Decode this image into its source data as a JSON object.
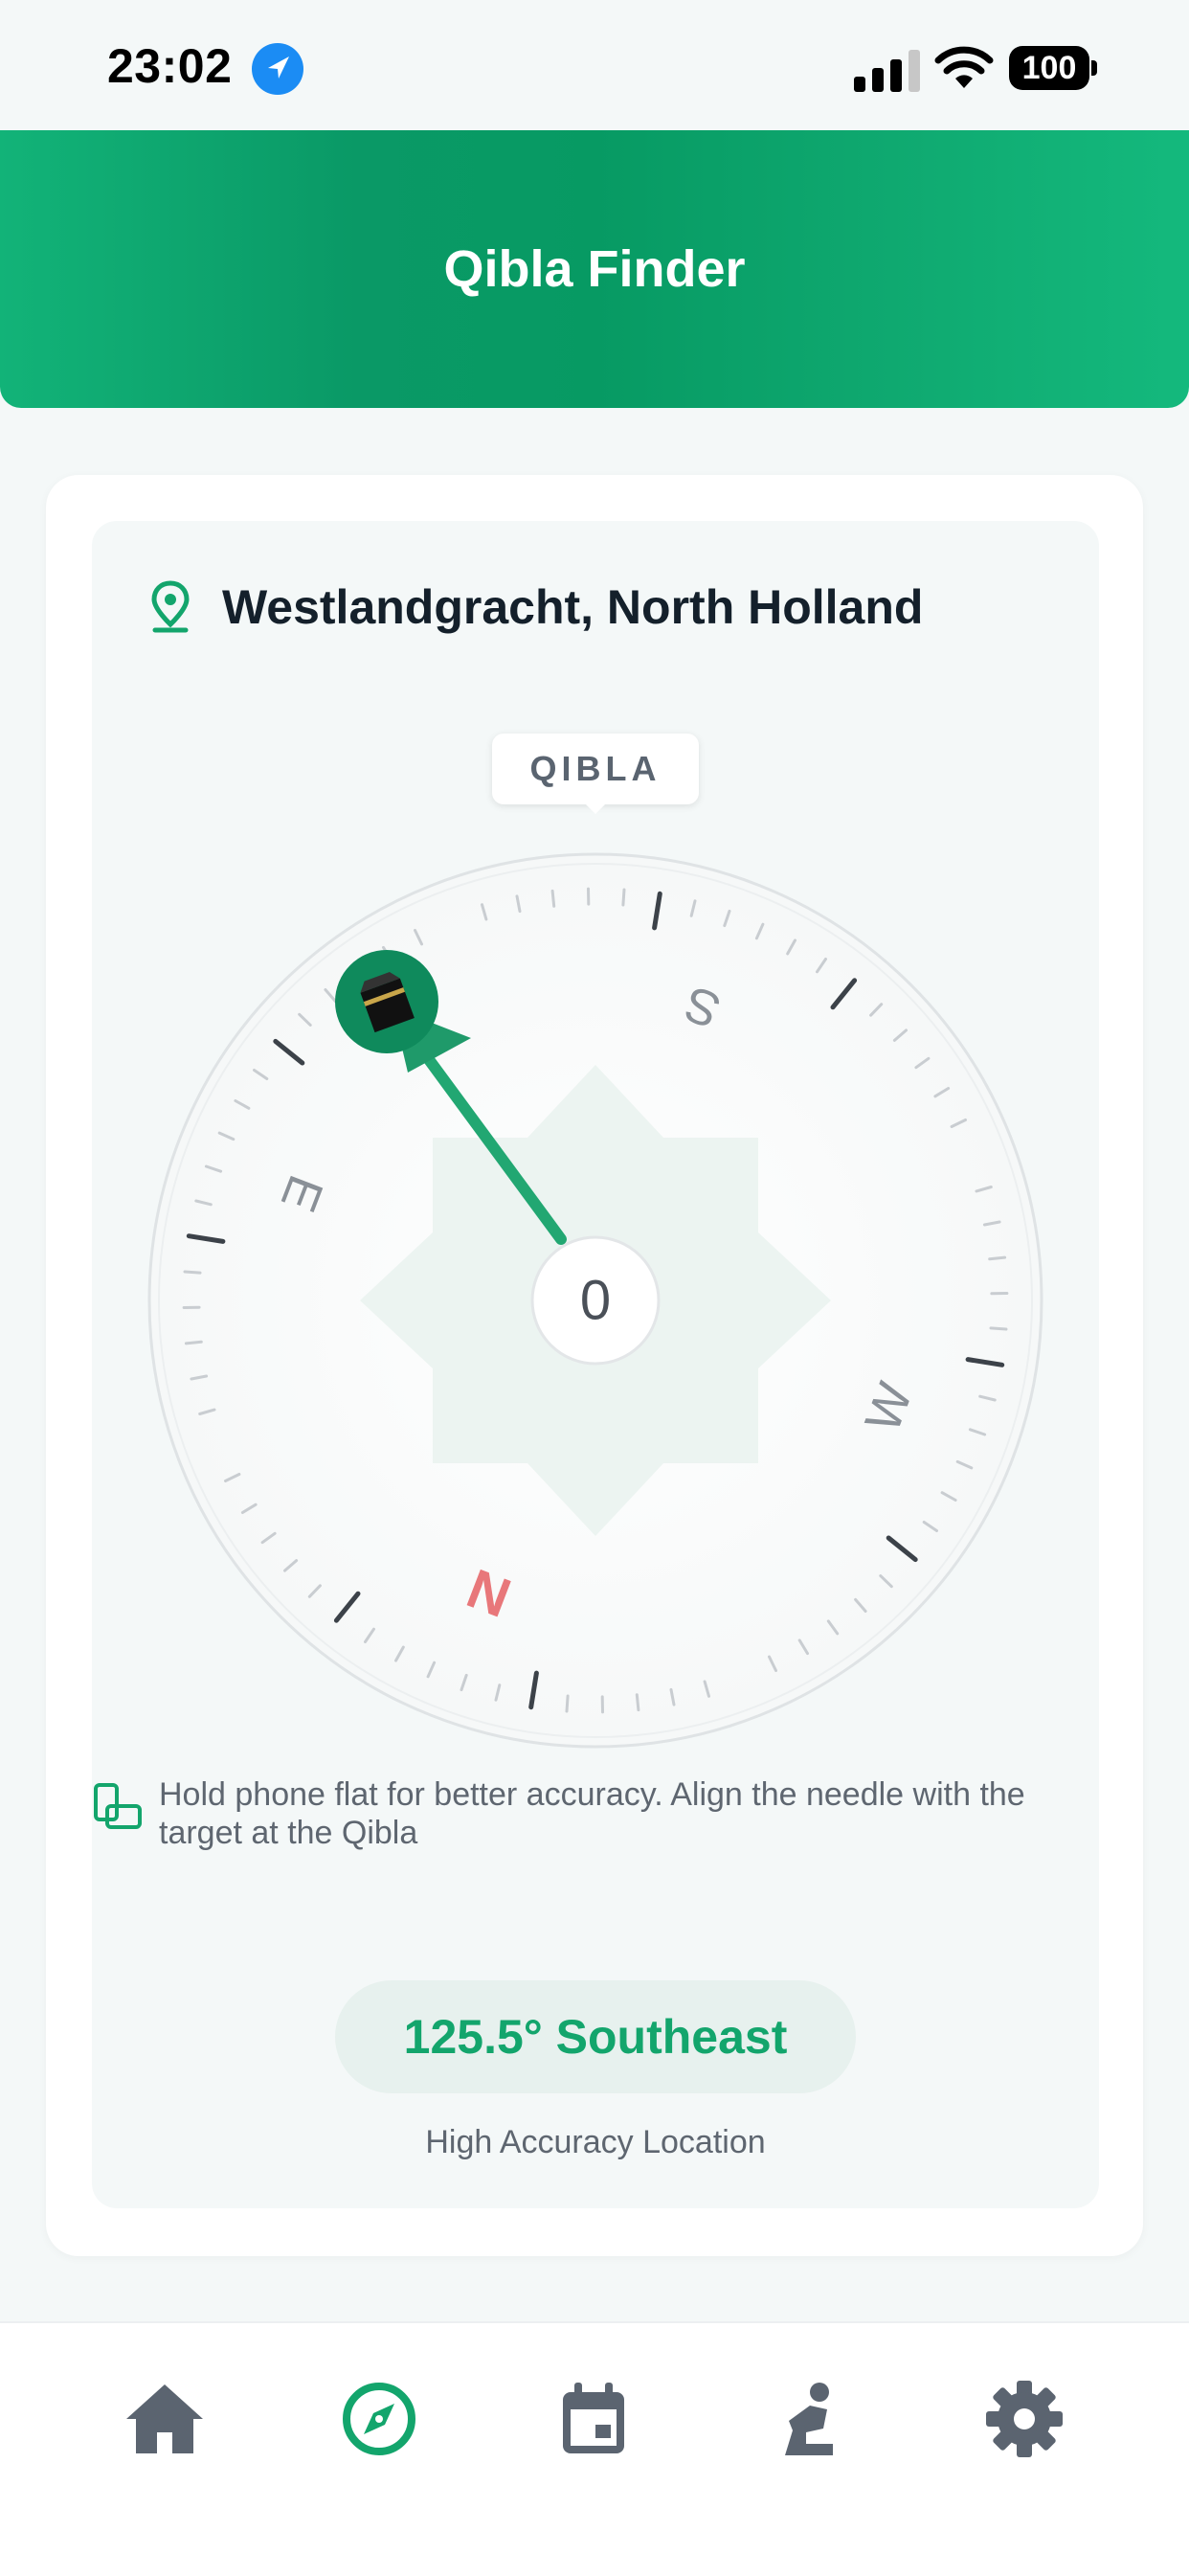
{
  "status_bar": {
    "time": "23:02",
    "battery": "100",
    "icons": [
      "location-arrow-icon",
      "signal-bars-icon",
      "wifi-icon",
      "battery-icon"
    ]
  },
  "header": {
    "title": "Qibla Finder",
    "gradient_color": "#0a9966"
  },
  "location": {
    "icon": "map-pin-icon",
    "text": "Westlandgracht, North Holland"
  },
  "compass": {
    "top_label": "QIBLA",
    "cardinals": {
      "n": "N",
      "e": "E",
      "s": "S",
      "w": "W"
    },
    "center_value": "0",
    "qibla_icon": "kaaba-icon",
    "accent_color": "#13a56c",
    "north_color": "#e8777a"
  },
  "hint": {
    "icon": "phone-flat-icon",
    "text": "Hold phone flat for better accuracy. Align the needle with the target at the Qibla"
  },
  "heading": {
    "text": "125.5° Southeast",
    "degrees": 125.5,
    "direction": "Southeast"
  },
  "accuracy": {
    "text": "High Accuracy Location"
  },
  "tabbar": {
    "active_index": 1,
    "items": [
      {
        "icon": "home-icon"
      },
      {
        "icon": "compass-icon"
      },
      {
        "icon": "calendar-icon"
      },
      {
        "icon": "prayer-icon"
      },
      {
        "icon": "settings-icon"
      }
    ],
    "active_color": "#13a56c",
    "inactive_color": "#5b6470"
  }
}
